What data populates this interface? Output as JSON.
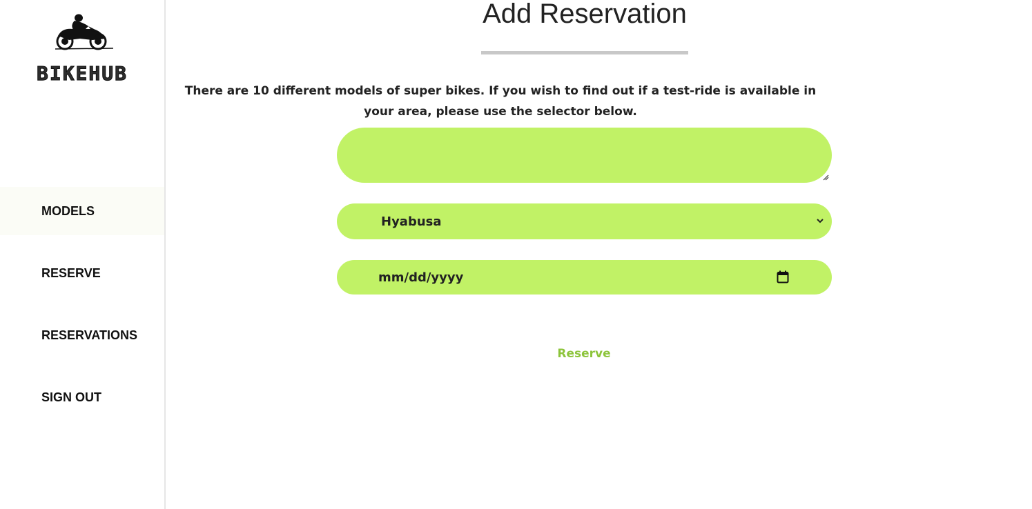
{
  "sidebar": {
    "brand": "BIKEHUB",
    "logo_icon": "motorcycle-rider-icon",
    "nav": [
      {
        "label": "MODELS",
        "active": true
      },
      {
        "label": "RESERVE",
        "active": false
      },
      {
        "label": "RESERVATIONS",
        "active": false
      },
      {
        "label": "SIGN OUT",
        "active": false
      }
    ]
  },
  "main": {
    "title": "Add Reservation",
    "intro": "There are 10 different models of super bikes. If you wish to find out if a test-ride is available in your area, please use the selector below.",
    "form": {
      "textarea_value": "",
      "model_select_value": "Hyabusa",
      "date_placeholder": "mm/dd/yyyy",
      "submit_label": "Reserve"
    }
  },
  "colors": {
    "accent_green": "#c1f266",
    "reserve_text": "#8cc43a",
    "title_rule": "#c8c8c8"
  }
}
